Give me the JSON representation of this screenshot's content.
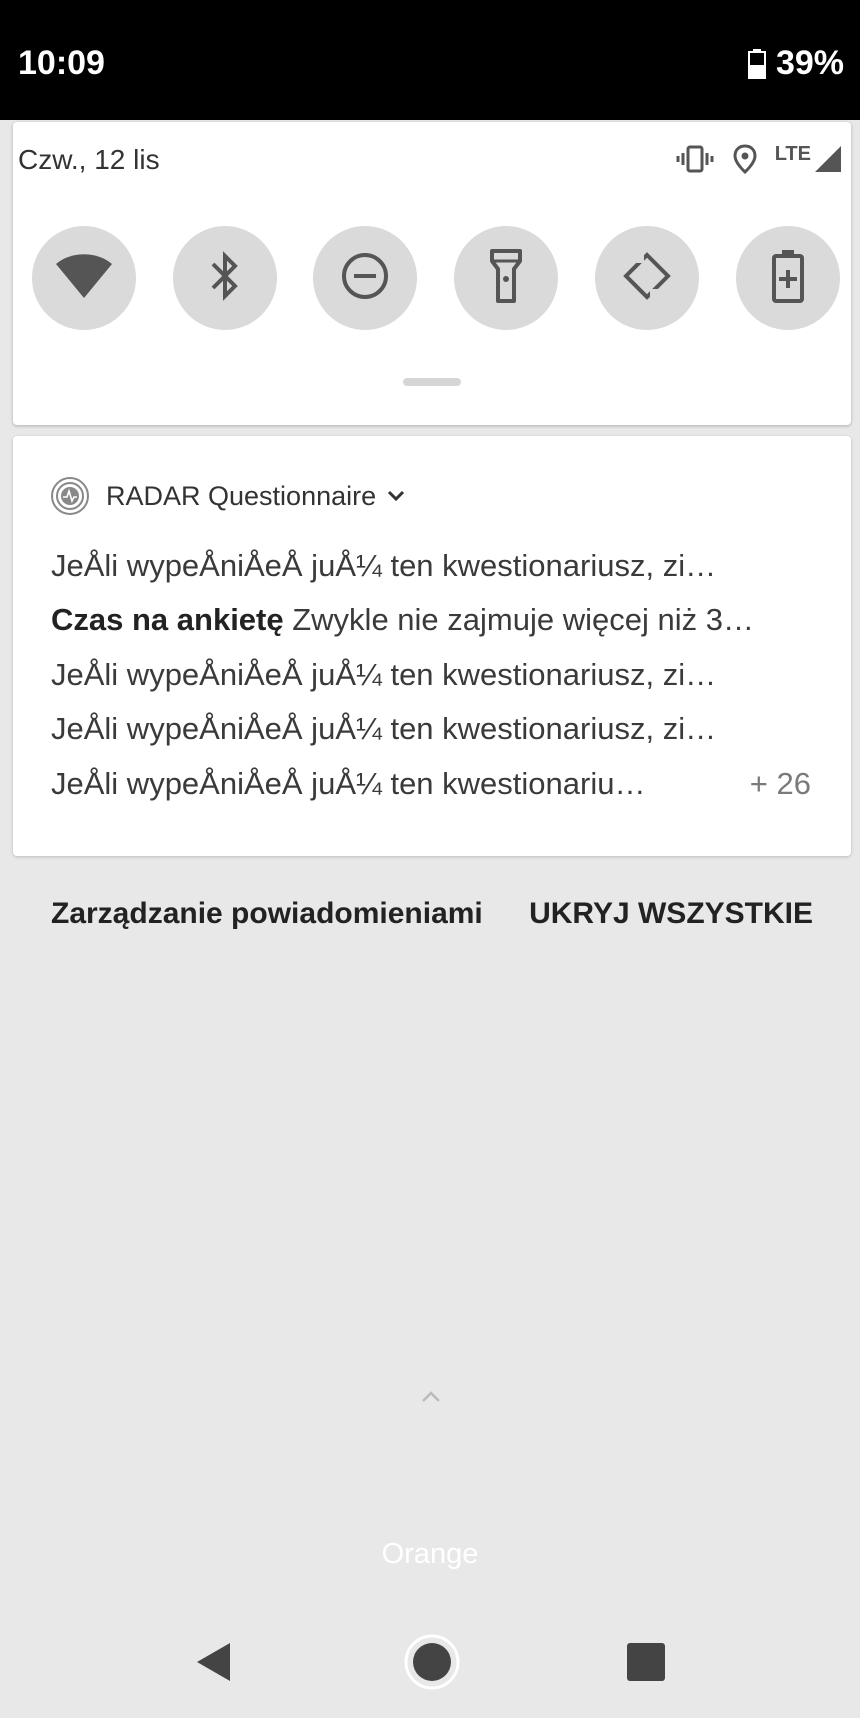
{
  "status_bar": {
    "time": "10:09",
    "battery": "39%",
    "icons": [
      "battery-icon"
    ]
  },
  "quick_settings": {
    "date": "Czw., 12 lis",
    "status_icons": [
      "vibrate-icon",
      "location-icon",
      "lte-signal-icon"
    ],
    "network_label": "LTE",
    "tiles": [
      {
        "name": "wifi",
        "icon": "wifi-icon"
      },
      {
        "name": "bluetooth",
        "icon": "bluetooth-icon"
      },
      {
        "name": "do-not-disturb",
        "icon": "dnd-icon"
      },
      {
        "name": "flashlight",
        "icon": "flashlight-icon"
      },
      {
        "name": "auto-rotate",
        "icon": "rotate-icon"
      },
      {
        "name": "battery-saver",
        "icon": "battery-saver-icon"
      }
    ]
  },
  "notification": {
    "app_name": "RADAR Questionnaire",
    "lines": [
      {
        "bold": "",
        "text": "JeÅli wypeÅniÅeÅ juÅ¼ ten kwestionariusz, zi…"
      },
      {
        "bold": "Czas na ankietę",
        "text": "Zwykle nie zajmuje więcej niż 3…"
      },
      {
        "bold": "",
        "text": "JeÅli wypeÅniÅeÅ juÅ¼ ten kwestionariusz, zi…"
      },
      {
        "bold": "",
        "text": "JeÅli wypeÅniÅeÅ juÅ¼ ten kwestionariusz, zi…"
      },
      {
        "bold": "",
        "text": "JeÅli wypeÅniÅeÅ juÅ¼ ten kwestionariu…"
      }
    ],
    "more_count": "+ 26"
  },
  "actions": {
    "manage": "Zarządzanie powiadomieniami",
    "hide_all": "UKRYJ WSZYSTKIE"
  },
  "carrier": "Orange",
  "nav": [
    "back-icon",
    "home-icon",
    "recents-icon"
  ]
}
